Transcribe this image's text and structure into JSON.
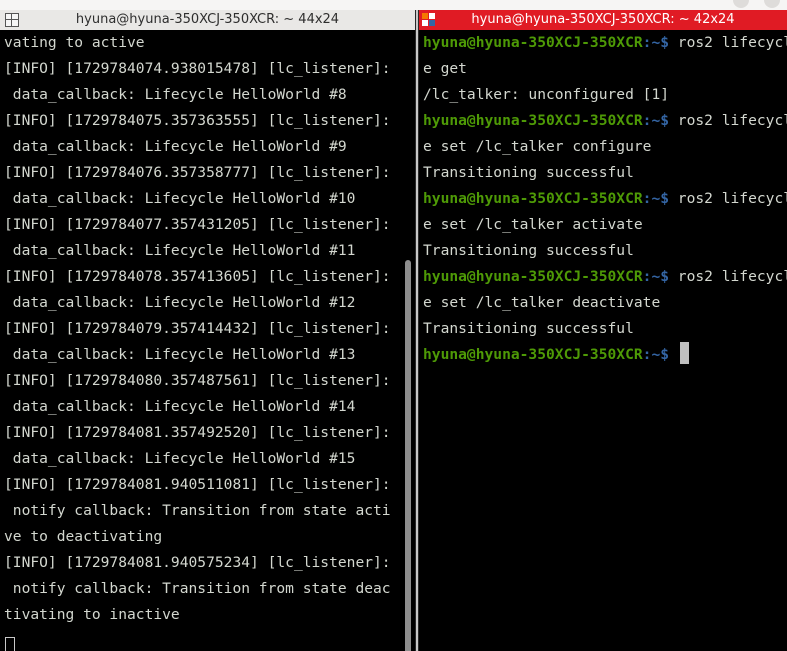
{
  "left_terminal": {
    "title": "hyuna@hyuna-350XCJ-350XCR: ~ 44x24",
    "lines": [
      "vating to active",
      "[INFO] [1729784074.938015478] [lc_listener]:",
      " data_callback: Lifecycle HelloWorld #8",
      "[INFO] [1729784075.357363555] [lc_listener]:",
      " data_callback: Lifecycle HelloWorld #9",
      "[INFO] [1729784076.357358777] [lc_listener]:",
      " data_callback: Lifecycle HelloWorld #10",
      "[INFO] [1729784077.357431205] [lc_listener]:",
      " data_callback: Lifecycle HelloWorld #11",
      "[INFO] [1729784078.357413605] [lc_listener]:",
      " data_callback: Lifecycle HelloWorld #12",
      "[INFO] [1729784079.357414432] [lc_listener]:",
      " data_callback: Lifecycle HelloWorld #13",
      "[INFO] [1729784080.357487561] [lc_listener]:",
      " data_callback: Lifecycle HelloWorld #14",
      "[INFO] [1729784081.357492520] [lc_listener]:",
      " data_callback: Lifecycle HelloWorld #15",
      "[INFO] [1729784081.940511081] [lc_listener]:",
      " notify callback: Transition from state acti",
      "ve to deactivating",
      "[INFO] [1729784081.940575234] [lc_listener]:",
      " notify callback: Transition from state deac",
      "tivating to inactive"
    ]
  },
  "right_terminal": {
    "title": "hyuna@hyuna-350XCJ-350XCR: ~ 42x24",
    "prompt_user": "hyuna@hyuna-350XCJ-350XCR",
    "prompt_path": ":~$",
    "lines": [
      {
        "prompt": true,
        "text": " ros2 lifecycl"
      },
      {
        "prompt": false,
        "text": "e get"
      },
      {
        "prompt": false,
        "text": "/lc_talker: unconfigured [1]"
      },
      {
        "prompt": true,
        "text": " ros2 lifecycl"
      },
      {
        "prompt": false,
        "text": "e set /lc_talker configure"
      },
      {
        "prompt": false,
        "text": "Transitioning successful"
      },
      {
        "prompt": true,
        "text": " ros2 lifecycl"
      },
      {
        "prompt": false,
        "text": "e set /lc_talker activate"
      },
      {
        "prompt": false,
        "text": "Transitioning successful"
      },
      {
        "prompt": true,
        "text": " ros2 lifecycl"
      },
      {
        "prompt": false,
        "text": "e set /lc_talker deactivate"
      },
      {
        "prompt": false,
        "text": "Transitioning successful"
      },
      {
        "prompt": true,
        "text": " ",
        "cursor": true
      }
    ]
  },
  "colors": {
    "terminal_bg": "#000000",
    "terminal_fg": "#d3d7cf",
    "prompt_user": "#4e9a06",
    "prompt_path": "#3465a4",
    "active_title_bg": "#e01b24",
    "inactive_title_bg": "#e9e8e6"
  },
  "icons": {
    "left_title": "split-terminal-icon",
    "right_title": "terminator-icon"
  }
}
